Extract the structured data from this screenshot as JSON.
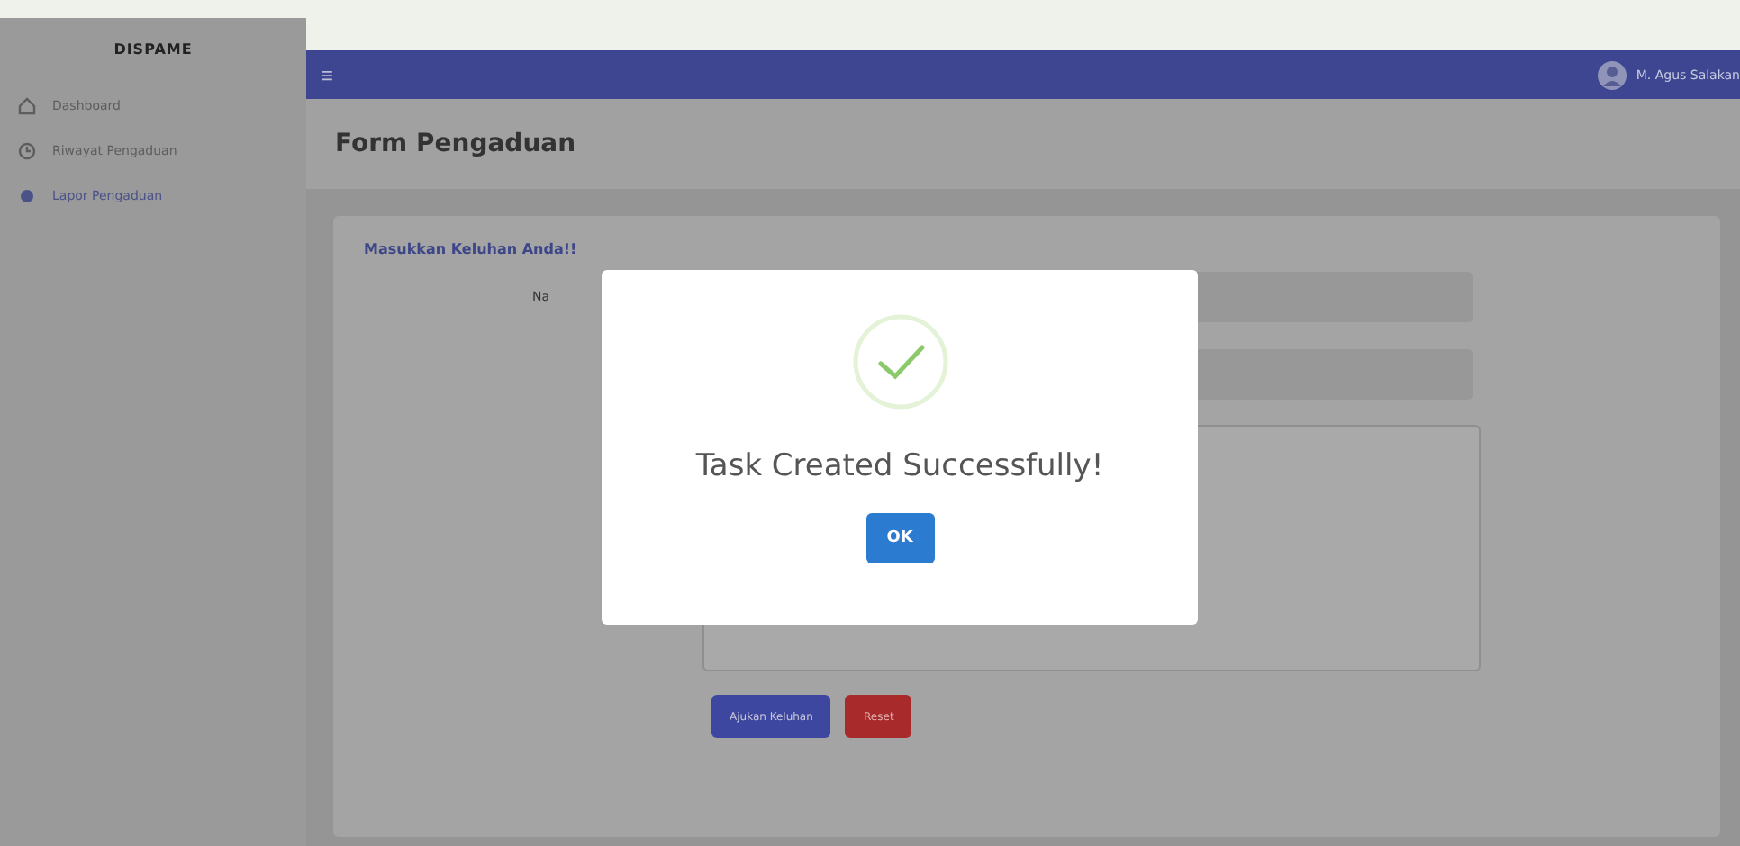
{
  "sidebar": {
    "brand": "DISPAME",
    "items": [
      {
        "label": "Dashboard",
        "selected": false
      },
      {
        "label": "Riwayat Pengaduan",
        "selected": false
      },
      {
        "label": "Lapor Pengaduan",
        "selected": true
      }
    ]
  },
  "navbar": {
    "menu_icon": "≡",
    "user": "M. Agus Salakan"
  },
  "page_title": "Form Pengaduan",
  "form": {
    "heading": "Masukkan Keluhan Anda!!",
    "first_label": "Na",
    "submit": "Ajukan Keluhan",
    "reset": "Reset"
  },
  "dialog": {
    "message": "Task Created Successfully!",
    "button": "OK"
  }
}
